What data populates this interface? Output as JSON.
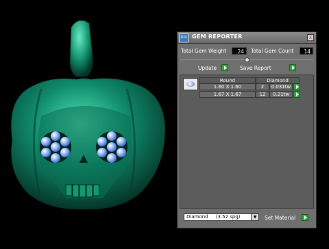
{
  "panel": {
    "title": "GEM REPORTER",
    "app_icon_text": "3DX",
    "close_symbol": "x",
    "total_gem_weight_label": "Total Gem Weight",
    "total_gem_weight_value": ".24",
    "total_gem_count_label": "Total Gem Count",
    "total_gem_count_value": "14",
    "update_label": "Update",
    "save_report_label": "Save Report",
    "table": {
      "headers": [
        "Round",
        "Diamond"
      ],
      "rows": [
        {
          "size": "1.60 X 1.60",
          "count": "2",
          "weight": "0.031tw"
        },
        {
          "size": "1.67 X 1.67",
          "count": "12",
          "weight": "0.21tw"
        }
      ]
    },
    "material_select": "Diamond     (3.52 spg)",
    "set_material_label": "Set Material"
  },
  "colors": {
    "model": "#0f8a6a",
    "gem": "#7fb0ff",
    "panel_bg": "#6f6f6f",
    "accent_green": "#2fa43a"
  },
  "icons": {
    "app": "app-icon",
    "close": "close-icon",
    "go": "play-arrow-icon",
    "gem_thumbnail": "round-gem-icon",
    "dropdown": "chevron-down-icon"
  }
}
